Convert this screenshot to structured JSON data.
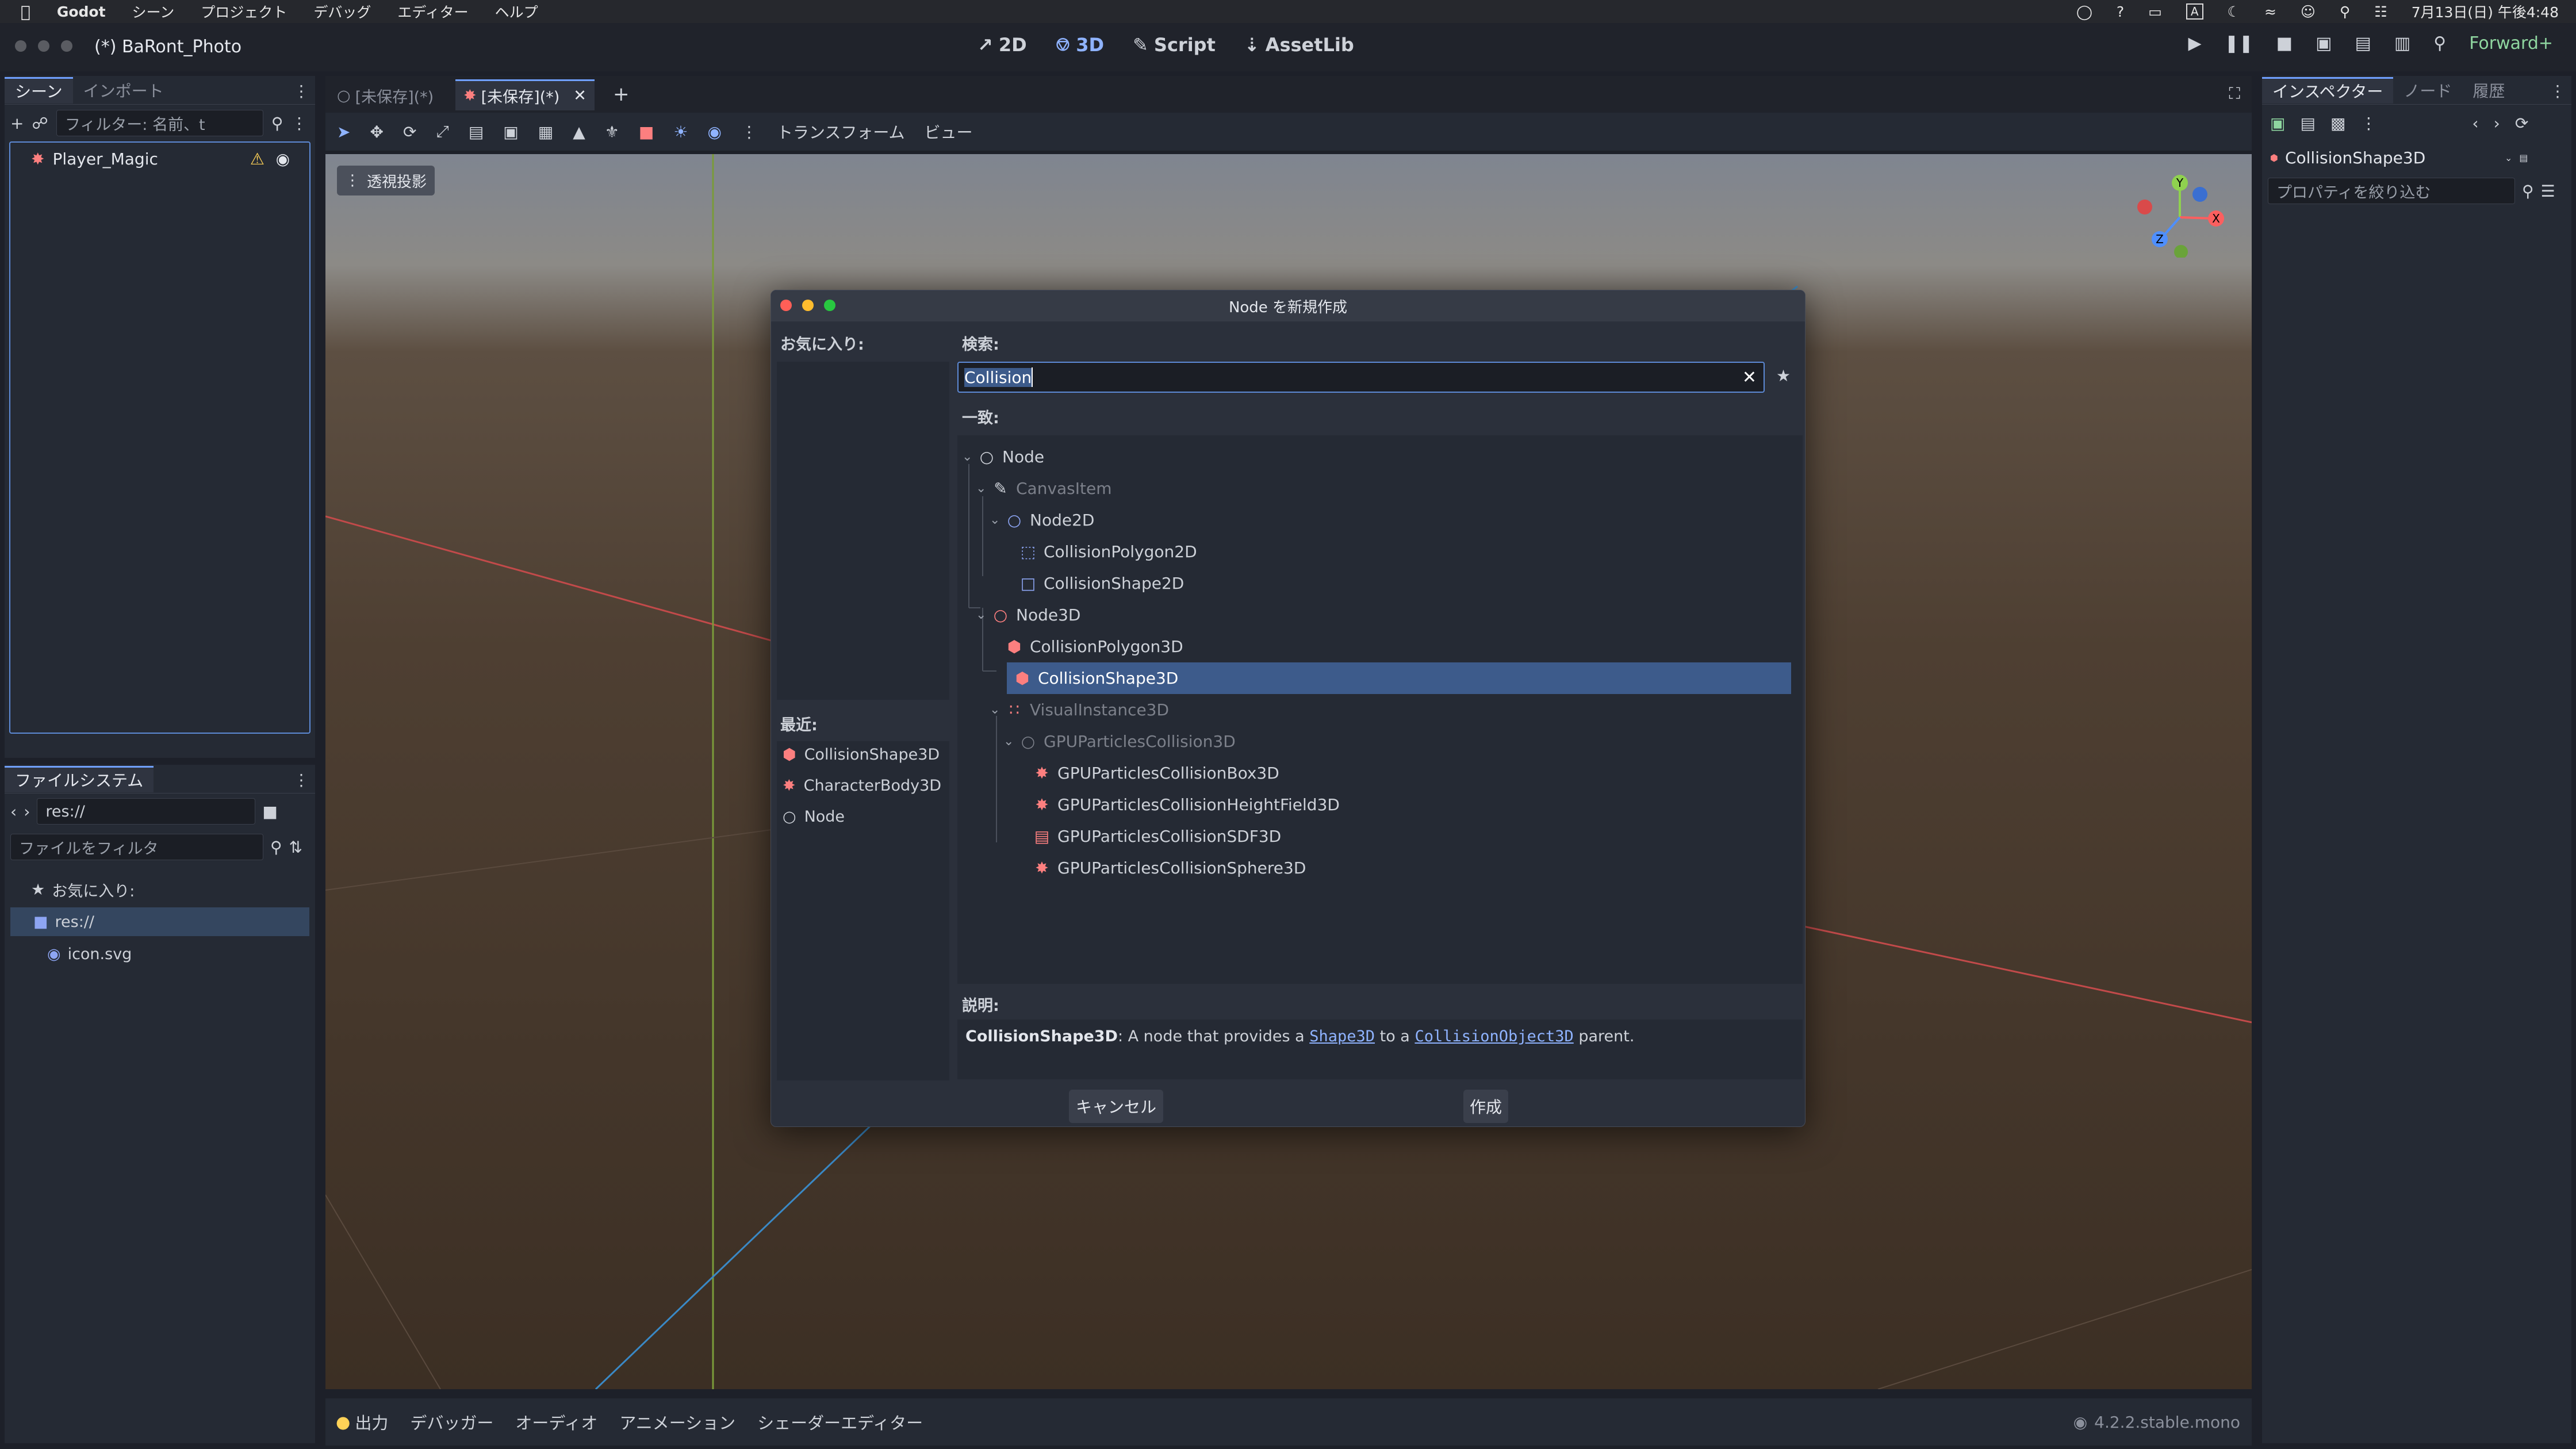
{
  "mac_menubar": {
    "apple": "",
    "items": [
      "Godot",
      "シーン",
      "プロジェクト",
      "デバッグ",
      "エディター",
      "ヘルプ"
    ],
    "status_icons": [
      "headphones-icon",
      "help-icon",
      "display-icon",
      "input-icon",
      "moon-icon",
      "wifi-icon",
      "user-icon",
      "search-icon",
      "control-center-icon"
    ],
    "input_badge": "A",
    "clock": "7月13日(日) 午後4:48"
  },
  "window": {
    "title": "(*) BaRont_Photo",
    "workspaces": [
      {
        "label": "2D",
        "icon": "2d-icon"
      },
      {
        "label": "3D",
        "icon": "3d-icon",
        "active": true
      },
      {
        "label": "Script",
        "icon": "script-icon"
      },
      {
        "label": "AssetLib",
        "icon": "assetlib-icon"
      }
    ],
    "renderer": "Forward+"
  },
  "scene_dock": {
    "tabs": [
      "シーン",
      "インポート"
    ],
    "filter_placeholder": "フィルター: 名前、t",
    "nodes": [
      {
        "name": "Player_Magic",
        "warning": true
      }
    ]
  },
  "filesystem_dock": {
    "title": "ファイルシステム",
    "path": "res://",
    "filter_placeholder": "ファイルをフィルタ",
    "items": [
      {
        "label": "お気に入り:",
        "icon": "star-icon"
      },
      {
        "label": "res://",
        "icon": "folder-icon",
        "selected": true
      },
      {
        "label": "icon.svg",
        "icon": "svg-icon"
      }
    ]
  },
  "editor_tabs": [
    {
      "label": "[未保存](*)",
      "icon": "node-circle-icon"
    },
    {
      "label": "[未保存](*)",
      "icon": "character-icon",
      "active": true
    }
  ],
  "viewport_toolbar": {
    "menus": [
      "トランスフォーム",
      "ビュー"
    ],
    "perspective_label": "透視投影"
  },
  "gizmo": {
    "x": "X",
    "y": "Y",
    "z": "Z"
  },
  "inspector": {
    "tabs": [
      "インスペクター",
      "ノード",
      "履歴"
    ],
    "selected_node": "CollisionShape3D",
    "filter_placeholder": "プロパティを絞り込む"
  },
  "dialog": {
    "title": "Node を新規作成",
    "favorites_label": "お気に入り:",
    "search_label": "検索:",
    "search_value": "Collision",
    "matches_label": "一致:",
    "recent_label": "最近:",
    "recent": [
      {
        "label": "CollisionShape3D",
        "icon": "collisionshape3d-icon"
      },
      {
        "label": "CharacterBody3D",
        "icon": "characterbody3d-icon"
      },
      {
        "label": "Node",
        "icon": "node-icon"
      }
    ],
    "tree": [
      {
        "label": "Node",
        "depth": 0,
        "icon": "node-icon",
        "expand": true
      },
      {
        "label": "CanvasItem",
        "depth": 1,
        "icon": "canvasitem-icon",
        "expand": true,
        "dim": true
      },
      {
        "label": "Node2D",
        "depth": 2,
        "icon": "node2d-icon",
        "expand": true
      },
      {
        "label": "CollisionPolygon2D",
        "depth": 3,
        "icon": "collisionpolygon2d-icon"
      },
      {
        "label": "CollisionShape2D",
        "depth": 3,
        "icon": "collisionshape2d-icon"
      },
      {
        "label": "Node3D",
        "depth": 1,
        "icon": "node3d-icon",
        "expand": true
      },
      {
        "label": "CollisionPolygon3D",
        "depth": 2,
        "icon": "collisionpolygon3d-icon"
      },
      {
        "label": "CollisionShape3D",
        "depth": 2,
        "icon": "collisionshape3d-icon",
        "selected": true
      },
      {
        "label": "VisualInstance3D",
        "depth": 2,
        "icon": "visualinstance3d-icon",
        "expand": true,
        "dim": true
      },
      {
        "label": "GPUParticlesCollision3D",
        "depth": 3,
        "icon": "gpuparticlescollision3d-icon",
        "expand": true,
        "dim": true
      },
      {
        "label": "GPUParticlesCollisionBox3D",
        "depth": 4,
        "icon": "gpu-box-icon"
      },
      {
        "label": "GPUParticlesCollisionHeightField3D",
        "depth": 4,
        "icon": "gpu-heightfield-icon"
      },
      {
        "label": "GPUParticlesCollisionSDF3D",
        "depth": 4,
        "icon": "gpu-sdf-icon"
      },
      {
        "label": "GPUParticlesCollisionSphere3D",
        "depth": 4,
        "icon": "gpu-sphere-icon"
      }
    ],
    "description_label": "説明:",
    "description": {
      "name": "CollisionShape3D",
      "text1": ": A node that provides a ",
      "link1": "Shape3D",
      "text2": " to a ",
      "link2": "CollisionObject3D",
      "text3": " parent."
    },
    "cancel_label": "キャンセル",
    "create_label": "作成"
  },
  "bottom_panel": {
    "tabs": [
      "出力",
      "デバッガー",
      "オーディオ",
      "アニメーション",
      "シェーダーエディター"
    ],
    "version": "4.2.2.stable.mono"
  },
  "colors": {
    "accent": "#70a0ff",
    "selection": "#3d5b8b",
    "node3d_red": "#fc7f7f",
    "node2d_blue": "#8da5f3"
  }
}
